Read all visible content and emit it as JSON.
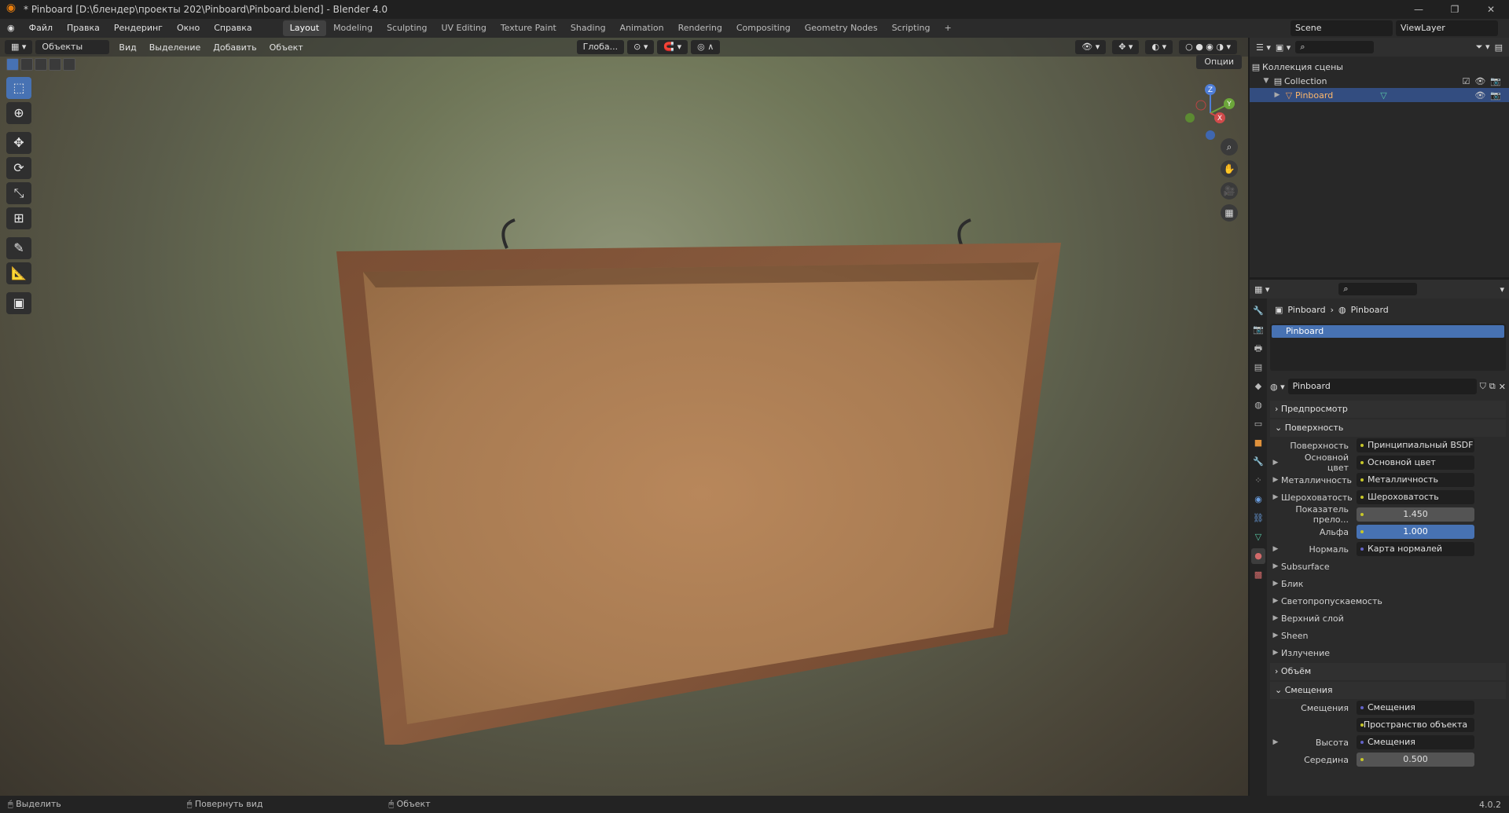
{
  "titlebar": {
    "title": "* Pinboard [D:\\блендер\\проекты 202\\Pinboard\\Pinboard.blend] - Blender 4.0",
    "minimize": "—",
    "maximize": "❐",
    "close": "✕"
  },
  "menu": {
    "items": [
      "Файл",
      "Правка",
      "Рендеринг",
      "Окно",
      "Справка"
    ],
    "workspaces": [
      "Layout",
      "Modeling",
      "Sculpting",
      "UV Editing",
      "Texture Paint",
      "Shading",
      "Animation",
      "Rendering",
      "Compositing",
      "Geometry Nodes",
      "Scripting",
      "+"
    ],
    "active_workspace": "Layout",
    "scene": "Scene",
    "view_layer": "ViewLayer"
  },
  "viewport": {
    "mode": "Объекты",
    "menus": [
      "Вид",
      "Выделение",
      "Добавить",
      "Объект"
    ],
    "orientation": "Глоба...",
    "options": "Опции",
    "gizmo": {
      "x": "X",
      "y": "Y",
      "z": "Z"
    }
  },
  "toolbar": {
    "tools": [
      "select-box",
      "cursor",
      "move",
      "rotate",
      "scale",
      "transform",
      "annotate",
      "measure",
      "add-cube"
    ]
  },
  "outliner": {
    "title": "Коллекция сцены",
    "collection": "Collection",
    "object": "Pinboard"
  },
  "props": {
    "breadcrumb_obj": "Pinboard",
    "breadcrumb_mat": "Pinboard",
    "slot": "Pinboard",
    "material_name": "Pinboard",
    "sections": {
      "preview": "Предпросмотр",
      "surface": "Поверхность",
      "volume": "Объём",
      "displacement": "Смещения"
    },
    "surface_label": "Поверхность",
    "surface_value": "Принципиальный BSDF",
    "rows": [
      {
        "label": "Основной цвет",
        "value": "Основной цвет"
      },
      {
        "label": "Металличность",
        "value": "Металличность"
      },
      {
        "label": "Шероховатость",
        "value": "Шероховатость"
      }
    ],
    "ior_label": "Показатель прело...",
    "ior": "1.450",
    "alpha_label": "Альфа",
    "alpha": "1.000",
    "normal_label": "Нормаль",
    "normal_value": "Карта нормалей",
    "subs": [
      "Subsurface",
      "Блик",
      "Светопропускаемость",
      "Верхний слой",
      "Sheen",
      "Излучение"
    ],
    "disp_label": "Смещения",
    "disp_value": "Смещения",
    "space_value": "Пространство объекта",
    "height_label": "Высота",
    "height_value": "Смещения",
    "mid_label": "Середина",
    "mid_value": "0.500"
  },
  "status": {
    "select": "Выделить",
    "rotate": "Повернуть вид",
    "object": "Объект",
    "version": "4.0.2"
  }
}
